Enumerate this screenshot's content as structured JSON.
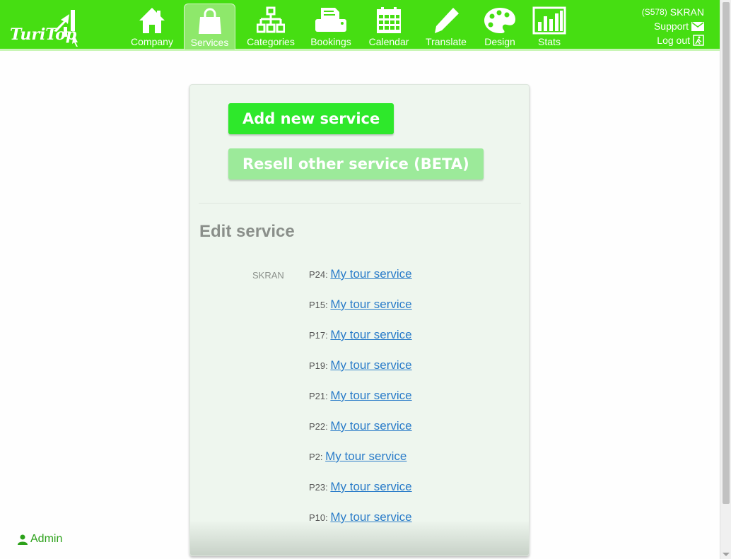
{
  "header": {
    "logo_text": "TuriTop",
    "nav": [
      {
        "label": "Company",
        "icon": "home-icon"
      },
      {
        "label": "Services",
        "icon": "shopping-bag-icon"
      },
      {
        "label": "Categories",
        "icon": "sitemap-icon"
      },
      {
        "label": "Bookings",
        "icon": "printer-icon"
      },
      {
        "label": "Calendar",
        "icon": "calendar-icon"
      },
      {
        "label": "Translate",
        "icon": "pencil-icon"
      },
      {
        "label": "Design",
        "icon": "palette-icon"
      },
      {
        "label": "Stats",
        "icon": "bar-chart-icon"
      }
    ],
    "active_nav": "Services",
    "user": {
      "id": "(S578)",
      "name": "SKRAN",
      "support_label": "Support",
      "logout_label": "Log out"
    }
  },
  "main": {
    "add_button": "Add new service",
    "resell_button": "Resell other service (BETA)",
    "section_title": "Edit service",
    "company": "SKRAN",
    "services": [
      {
        "code": "P24:",
        "name": "My tour service"
      },
      {
        "code": "P15:",
        "name": "My tour service"
      },
      {
        "code": "P17:",
        "name": "My tour service"
      },
      {
        "code": "P19:",
        "name": "My tour service"
      },
      {
        "code": "P21:",
        "name": "My tour service"
      },
      {
        "code": "P22:",
        "name": "My tour service"
      },
      {
        "code": "P2:",
        "name": "My tour service"
      },
      {
        "code": "P23:",
        "name": "My tour service"
      },
      {
        "code": "P10:",
        "name": "My tour service"
      }
    ]
  },
  "footer": {
    "admin_label": "Admin"
  },
  "colors": {
    "brand_green": "#46de12",
    "button_green": "#2ee82b",
    "button_light_green": "#9cea9a",
    "link_blue": "#2a7cc9"
  }
}
